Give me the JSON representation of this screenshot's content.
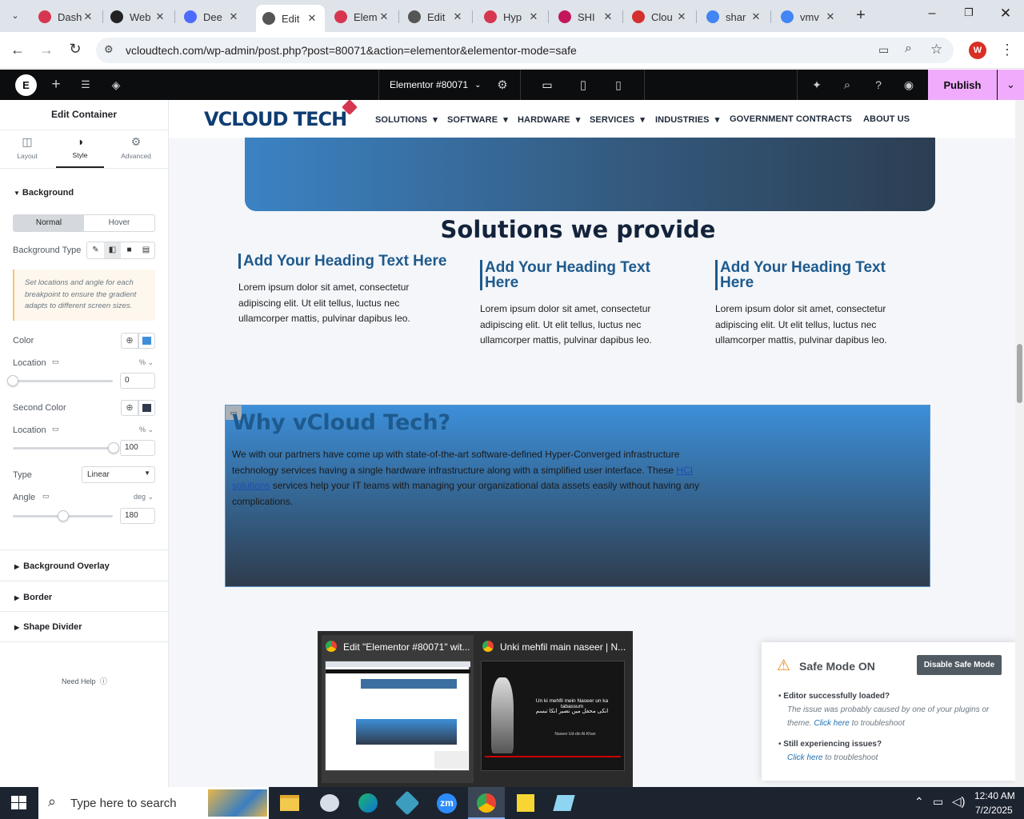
{
  "tabs": [
    {
      "label": "Dash",
      "color": "#d63650"
    },
    {
      "label": "Web",
      "color": "#222"
    },
    {
      "label": "Dee",
      "color": "#4d6bfe"
    },
    {
      "label": "Edit",
      "color": "#555"
    },
    {
      "label": "Elem",
      "color": "#d63650"
    },
    {
      "label": "Edit",
      "color": "#555"
    },
    {
      "label": "Hyp",
      "color": "#d63650"
    },
    {
      "label": "SHI",
      "color": "#c2185b"
    },
    {
      "label": "Clou",
      "color": "#d32f2f"
    },
    {
      "label": "shar",
      "color": "#4285f4"
    },
    {
      "label": "vmv",
      "color": "#4285f4"
    }
  ],
  "browser": {
    "url": "vcloudtech.com/wp-admin/post.php?post=80071&action=elementor&elementor-mode=safe",
    "avatar": "W"
  },
  "editor": {
    "doc_title": "Elementor #80071",
    "publish": "Publish"
  },
  "panel": {
    "title": "Edit Container",
    "tabs": [
      "Layout",
      "Style",
      "Advanced"
    ],
    "section": "Background",
    "state_tabs": [
      "Normal",
      "Hover"
    ],
    "bg_type_label": "Background Type",
    "hint": "Set locations and angle for each breakpoint to ensure the gradient adapts to different screen sizes.",
    "color_label": "Color",
    "location_label": "Location",
    "location1": "0",
    "second_color_label": "Second Color",
    "location2": "100",
    "unit_pct": "%",
    "type_label": "Type",
    "type_value": "Linear",
    "angle_label": "Angle",
    "angle_unit": "deg",
    "angle_value": "180",
    "sections": [
      "Background Overlay",
      "Border",
      "Shape Divider"
    ],
    "help": "Need Help",
    "color1": "#3d8fd9",
    "color2": "#2f3b4c"
  },
  "site": {
    "logo_main": "VCLOUD TECH",
    "nav": [
      "SOLUTIONS",
      "SOFTWARE",
      "HARDWARE",
      "SERVICES",
      "INDUSTRIES",
      "GOVERNMENT CONTRACTS",
      "ABOUT US"
    ],
    "section_title": "Solutions we provide",
    "columns": [
      {
        "heading": "Add Your Heading Text Here",
        "body": "Lorem ipsum dolor sit amet, consectetur adipiscing elit. Ut elit tellus, luctus nec ullamcorper mattis, pulvinar dapibus leo."
      },
      {
        "heading": "Add Your Heading Text Here",
        "body": "Lorem ipsum dolor sit amet, consectetur adipiscing elit. Ut elit tellus, luctus nec ullamcorper mattis, pulvinar dapibus leo."
      },
      {
        "heading": "Add Your Heading Text Here",
        "body": "Lorem ipsum dolor sit amet, consectetur adipiscing elit. Ut elit tellus, luctus nec ullamcorper mattis, pulvinar dapibus leo."
      }
    ],
    "why_title": "Why vCloud Tech?",
    "why_text_1": "We with our partners have come up with state-of-the-art software-defined Hyper-Converged infrastructure technology services having a single hardware infrastructure along with a simplified user interface. These ",
    "why_link": "HCI solutions",
    "why_text_2": " services help your IT teams with managing your organizational data assets easily without having any complications."
  },
  "previews": [
    {
      "title": "Edit \"Elementor #80071\" wit..."
    },
    {
      "title": "Unki mehfil main naseer | N...",
      "line1": "Un ki mehfil mein Naseer un ka tabassum",
      "line2": "انکی محفل میں نصیر انکا تبسم",
      "credit": "Naseer Ud-din Al-Khan"
    }
  ],
  "safe_mode": {
    "title": "Safe Mode ON",
    "button": "Disable Safe Mode",
    "item1_title": "Editor successfully loaded?",
    "item1_text": "The issue was probably caused by one of your plugins or theme.",
    "item1_link": "Click here",
    "item1_suffix": "to troubleshoot",
    "item2_title": "Still experiencing issues?",
    "item2_link": "Click here",
    "item2_suffix": "to troubleshoot"
  },
  "taskbar": {
    "search": "Type here to search",
    "time": "12:40 AM",
    "date": "7/2/2025"
  }
}
